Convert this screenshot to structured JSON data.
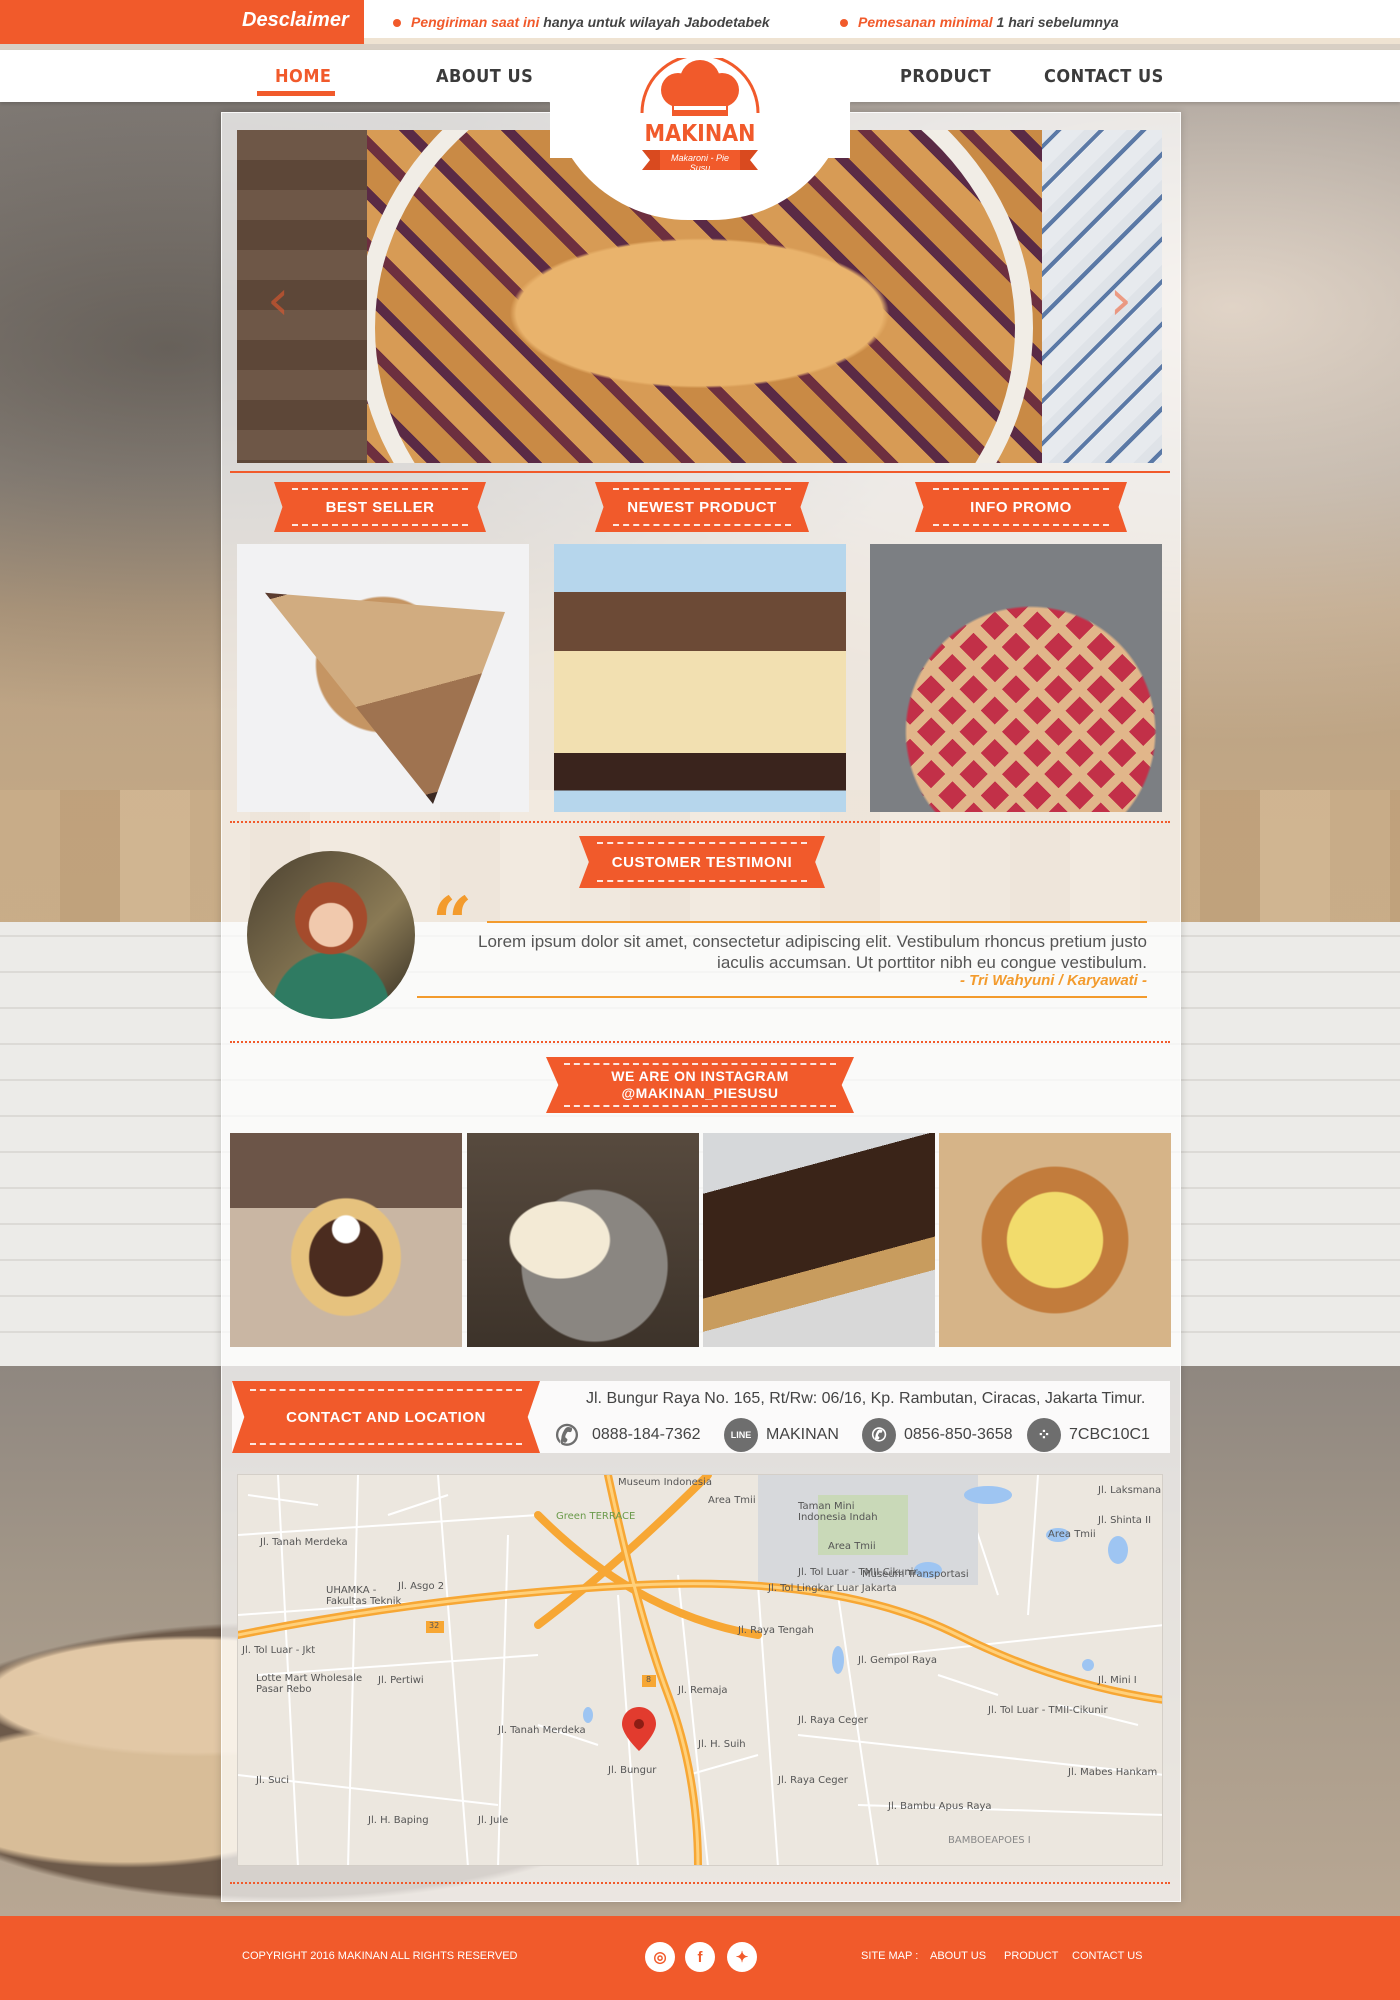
{
  "topbar": {
    "disclaimer_label": "Desclaimer",
    "notices": [
      {
        "highlight": "Pengiriman saat ini",
        "rest": " hanya untuk wilayah Jabodetabek"
      },
      {
        "highlight": "Pemesanan minimal",
        "rest": " 1 hari sebelumnya"
      }
    ]
  },
  "nav": {
    "items": [
      "HOME",
      "ABOUT US",
      "PRODUCT",
      "CONTACT US"
    ],
    "active": "HOME"
  },
  "logo": {
    "brand": "MAKINAN",
    "tagline": "Makaroni - Pie Susu"
  },
  "slider": {
    "prev_icon": "chevron-left-icon",
    "next_icon": "chevron-right-icon"
  },
  "sections": {
    "best_seller": "BEST SELLER",
    "newest_product": "NEWEST PRODUCT",
    "info_promo": "INFO PROMO",
    "customer_testimoni": "CUSTOMER TESTIMONI",
    "instagram_line1": "WE ARE ON INSTAGRAM",
    "instagram_line2": "@MAKINAN_PIESUSU",
    "contact_location": "CONTACT  AND LOCATION"
  },
  "testimonial": {
    "text": "Lorem ipsum dolor sit amet, consectetur adipiscing elit. Vestibulum rhoncus pretium justo iaculis accumsan. Ut porttitor nibh eu congue vestibulum.",
    "author": "- Tri Wahyuni / Karyawati -"
  },
  "contact": {
    "address": "Jl. Bungur Raya No. 165, Rt/Rw: 06/16, Kp. Rambutan, Ciracas, Jakarta Timur.",
    "phone": "0888-184-7362",
    "line": "MAKINAN",
    "whatsapp": "0856-850-3658",
    "bbm": "7CBC10C1",
    "line_icon_text": "LINE"
  },
  "map": {
    "labels": [
      "Museum Indonesia",
      "Area Tmii",
      "Green TERRACE",
      "Taman Mini Indonesia Indah",
      "Area Tmii",
      "Area Tmii",
      "Museum Transportasi",
      "Jl. Tanah Merdeka",
      "UHAMKA - Fakultas Teknik",
      "Jl. Asgo 2",
      "Jl. Tol Luar - Jkt",
      "Lotte Mart Wholesale Pasar Rebo",
      "Jl. Tol Lingkar Luar Jakarta",
      "Jl. Raya Tengah",
      "Jl. Gempol Raya",
      "Jl. Remaja",
      "Jl. H. Suih",
      "Jl. Bungur",
      "Jl. Bambu Apus Raya",
      "BAMBOEAPOES I",
      "Jl. Mabes Hankam",
      "Jl. Suci",
      "Jl. Tol Luar - TMII-Cikunir",
      "Jl. Tol Luar - TMII-Cikunir",
      "Jl. Raya Ceger",
      "Jl. Raya Ceger",
      "Jl. Tanah Merdeka",
      "Jl. H. Baping",
      "Jl. Jule",
      "Jl. Pertiwi",
      "Jl. Mini I",
      "Jl. Laksmana",
      "Jl. Shinta II"
    ],
    "highway_marker_32": "32",
    "highway_marker_8": "8"
  },
  "footer": {
    "copyright_prefix": "COPYRIGHT 2016 ",
    "copyright_brand": "MAKINAN",
    "copyright_suffix": " ALL RIGHTS RESERVED",
    "social_icons": [
      "instagram-icon",
      "facebook-icon",
      "twitter-icon"
    ],
    "sitemap_label": "SITE MAP :",
    "sitemap_links": [
      "ABOUT US",
      "PRODUCT",
      "CONTACT US"
    ]
  },
  "colors": {
    "accent": "#f15a2b",
    "quote": "#f39b2d"
  }
}
